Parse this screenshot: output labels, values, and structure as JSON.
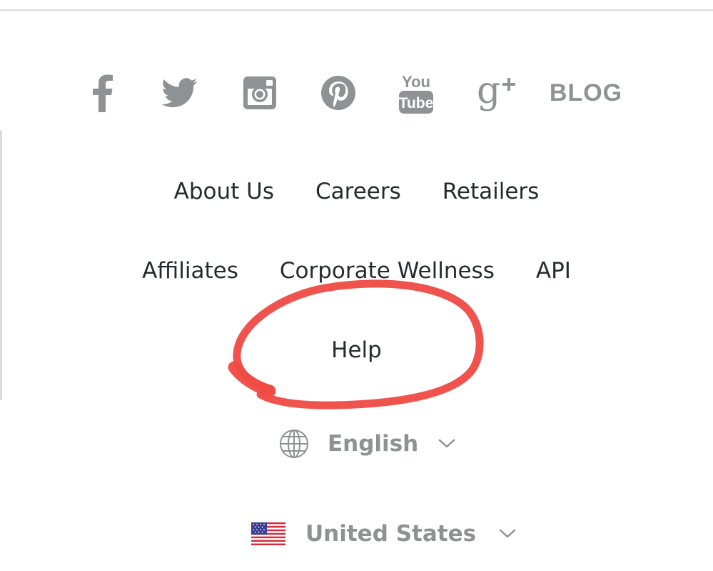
{
  "social": {
    "facebook_icon": "facebook-icon",
    "twitter_icon": "twitter-icon",
    "instagram_icon": "instagram-icon",
    "pinterest_icon": "pinterest-icon",
    "youtube_icon": "youtube-icon",
    "youtube_top": "You",
    "youtube_bottom": "Tube",
    "googleplus_icon": "google-plus-icon",
    "blog_label": "BLOG"
  },
  "nav": {
    "row1": [
      "About Us",
      "Careers",
      "Retailers"
    ],
    "row2": [
      "Affiliates",
      "Corporate Wellness",
      "API"
    ],
    "row3": [
      "Help"
    ]
  },
  "language": {
    "icon": "globe-icon",
    "selected": "English"
  },
  "country": {
    "icon": "us-flag-icon",
    "selected": "United States"
  },
  "colors": {
    "icon_gray": "#8e9295",
    "link_text": "#272b30",
    "annotation_red": "#ef4a43"
  }
}
